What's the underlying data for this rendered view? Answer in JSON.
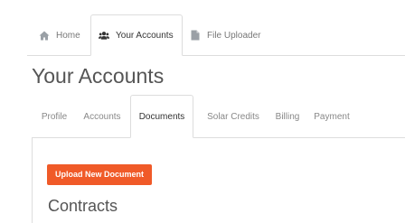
{
  "top_nav": {
    "tabs": [
      {
        "label": "Home",
        "icon": "home-icon",
        "active": false
      },
      {
        "label": "Your Accounts",
        "icon": "users-icon",
        "active": true
      },
      {
        "label": "File Uploader",
        "icon": "file-icon",
        "active": false
      }
    ]
  },
  "page": {
    "title": "Your Accounts"
  },
  "sub_nav": {
    "tabs": [
      {
        "label": "Profile",
        "active": false
      },
      {
        "label": "Accounts",
        "active": false
      },
      {
        "label": "Documents",
        "active": true
      },
      {
        "label": "Solar Credits",
        "active": false
      },
      {
        "label": "Billing",
        "active": false
      },
      {
        "label": "Payment",
        "active": false
      }
    ]
  },
  "content": {
    "upload_button_label": "Upload New Document",
    "section_title": "Contracts"
  },
  "colors": {
    "accent": "#f05a28",
    "border": "#dddddd",
    "text": "#555555"
  }
}
